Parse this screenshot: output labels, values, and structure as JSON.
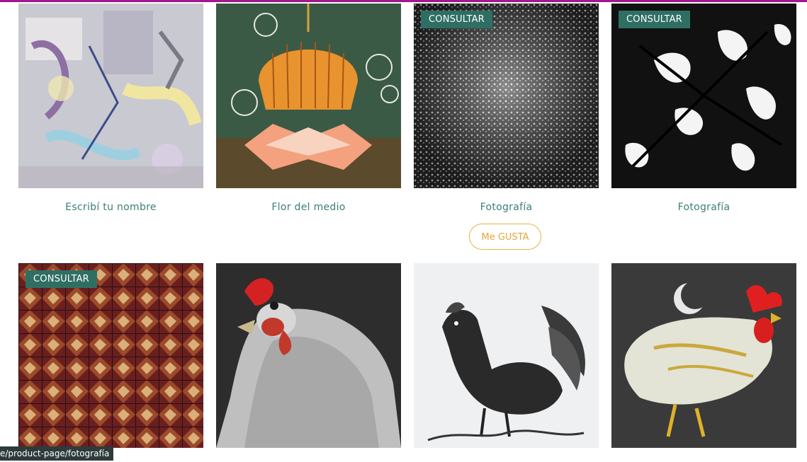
{
  "products_row1": [
    {
      "title": "Escribí tu nombre",
      "ribbon": ""
    },
    {
      "title": "Flor del medio",
      "ribbon": ""
    },
    {
      "title": "Fotografía",
      "ribbon": "CONSULTAR"
    },
    {
      "title": "Fotografía",
      "ribbon": "CONSULTAR"
    }
  ],
  "products_row2": [
    {
      "title": "",
      "ribbon": "CONSULTAR"
    },
    {
      "title": "",
      "ribbon": ""
    },
    {
      "title": "",
      "ribbon": ""
    },
    {
      "title": "",
      "ribbon": ""
    }
  ],
  "like_button": {
    "label": "Me GUSTA"
  },
  "status_bar": {
    "url": "e/product-page/fotografía"
  },
  "colors": {
    "accent_bar": "#a3178e",
    "ribbon": "#2f6f63",
    "title_text": "#3a7f75",
    "like_border": "#e3b64b"
  }
}
